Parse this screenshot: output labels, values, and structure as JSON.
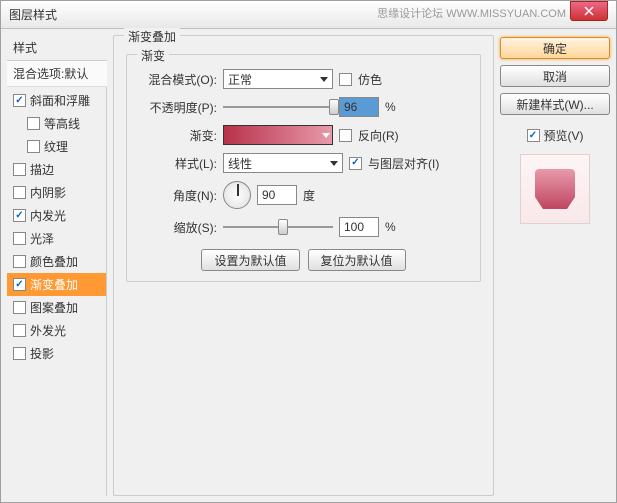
{
  "title": "图层样式",
  "watermark": "思缘设计论坛  WWW.MISSYUAN.COM",
  "left": {
    "header": "样式",
    "sub": "混合选项:默认",
    "items": [
      {
        "label": "斜面和浮雕",
        "checked": true,
        "indent": false,
        "selected": false
      },
      {
        "label": "等高线",
        "checked": false,
        "indent": true,
        "selected": false
      },
      {
        "label": "纹理",
        "checked": false,
        "indent": true,
        "selected": false
      },
      {
        "label": "描边",
        "checked": false,
        "indent": false,
        "selected": false
      },
      {
        "label": "内阴影",
        "checked": false,
        "indent": false,
        "selected": false
      },
      {
        "label": "内发光",
        "checked": true,
        "indent": false,
        "selected": false
      },
      {
        "label": "光泽",
        "checked": false,
        "indent": false,
        "selected": false
      },
      {
        "label": "颜色叠加",
        "checked": false,
        "indent": false,
        "selected": false
      },
      {
        "label": "渐变叠加",
        "checked": true,
        "indent": false,
        "selected": true
      },
      {
        "label": "图案叠加",
        "checked": false,
        "indent": false,
        "selected": false
      },
      {
        "label": "外发光",
        "checked": false,
        "indent": false,
        "selected": false
      },
      {
        "label": "投影",
        "checked": false,
        "indent": false,
        "selected": false
      }
    ]
  },
  "center": {
    "group_title": "渐变叠加",
    "inner_title": "渐变",
    "blend_label": "混合模式(O):",
    "blend_value": "正常",
    "dither_label": "仿色",
    "opacity_label": "不透明度(P):",
    "opacity_value": "96",
    "opacity_unit": "%",
    "gradient_label": "渐变:",
    "reverse_label": "反向(R)",
    "style_label": "样式(L):",
    "style_value": "线性",
    "align_label": "与图层对齐(I)",
    "align_checked": true,
    "angle_label": "角度(N):",
    "angle_value": "90",
    "angle_unit": "度",
    "scale_label": "缩放(S):",
    "scale_value": "100",
    "scale_unit": "%",
    "btn_default": "设置为默认值",
    "btn_reset": "复位为默认值"
  },
  "right": {
    "ok": "确定",
    "cancel": "取消",
    "newstyle": "新建样式(W)...",
    "preview_label": "预览(V)",
    "preview_checked": true
  }
}
